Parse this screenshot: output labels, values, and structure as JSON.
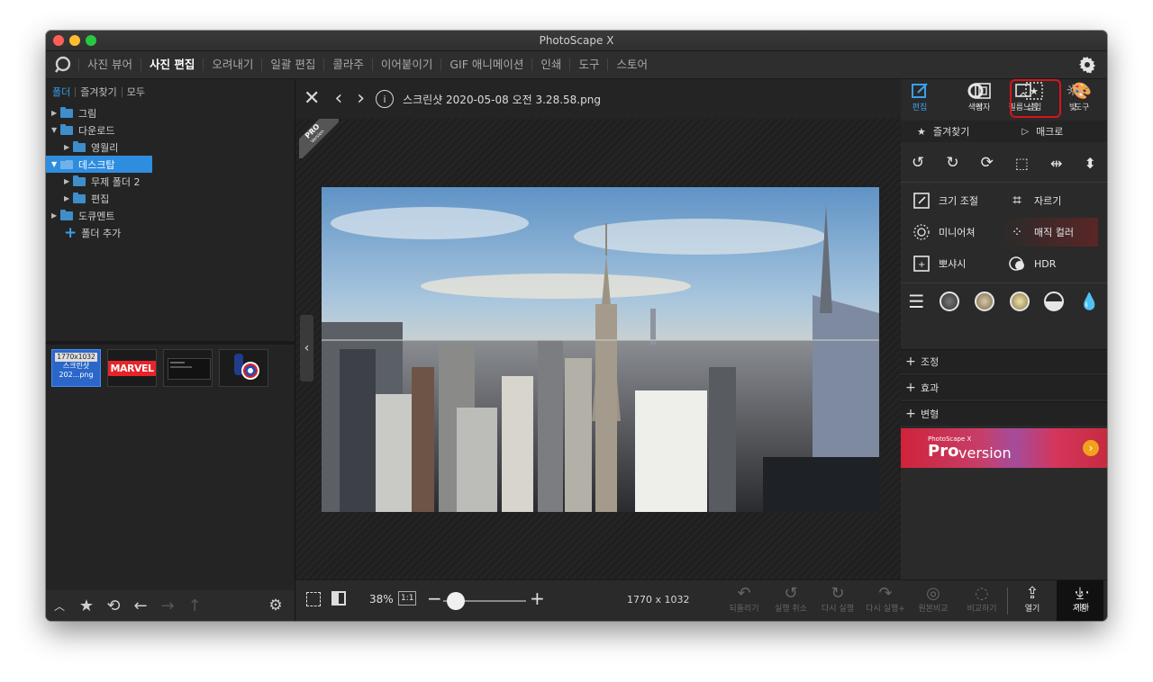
{
  "window": {
    "title": "PhotoScape X"
  },
  "menu": {
    "items": [
      "사진 뷰어",
      "사진 편집",
      "오려내기",
      "일괄 편집",
      "콜라주",
      "이어붙이기",
      "GIF 애니메이션",
      "인쇄",
      "도구",
      "스토어"
    ],
    "active": "사진 편집"
  },
  "left_panel": {
    "tabs": [
      "폴더",
      "즐겨찾기",
      "모두"
    ],
    "tree": [
      {
        "label": "그림",
        "expanded": false,
        "level": 0
      },
      {
        "label": "다운로드",
        "expanded": true,
        "level": 0
      },
      {
        "label": "영월리",
        "expanded": false,
        "level": 1
      },
      {
        "label": "데스크탑",
        "expanded": true,
        "level": 0,
        "selected": true
      },
      {
        "label": "무제 폴더 2",
        "expanded": false,
        "level": 1
      },
      {
        "label": "편집",
        "expanded": false,
        "level": 1
      },
      {
        "label": "도큐멘트",
        "expanded": false,
        "level": 0
      }
    ],
    "add_folder": "폴더 추가",
    "thumbnails": [
      {
        "line1": "1770x1032",
        "line2": "스크린샷",
        "line3": "202...png",
        "selected": true
      },
      {
        "label": "MARVEL"
      },
      {
        "label": ""
      },
      {
        "label": ""
      }
    ]
  },
  "editor": {
    "filename": "스크린샷 2020-05-08 오전 3.28.58.png",
    "pro_badge": "PRO",
    "pro_badge_sub": "Version",
    "zoom": "38%",
    "one_to_one": "1:1",
    "dimensions": "1770 x 1032"
  },
  "bottom_actions": [
    {
      "label": "되돌리기",
      "enabled": false
    },
    {
      "label": "실행 취소",
      "enabled": false
    },
    {
      "label": "다시 실행",
      "enabled": false
    },
    {
      "label": "다시 실행+",
      "enabled": false
    },
    {
      "label": "원본비교",
      "enabled": false
    },
    {
      "label": "비교하기",
      "enabled": false
    },
    {
      "label": "열기",
      "enabled": true
    },
    {
      "label": "저장",
      "enabled": true
    },
    {
      "label": "기타",
      "enabled": true
    }
  ],
  "right_toolbar": [
    {
      "label": "편집",
      "icon": "edit-icon",
      "active": true
    },
    {
      "label": "색상",
      "icon": "color-icon"
    },
    {
      "label": "필름느낌",
      "icon": "film-icon"
    },
    {
      "label": "빛",
      "icon": "light-icon"
    },
    {
      "label": "액자",
      "icon": "frame-icon"
    },
    {
      "label": "삽입",
      "icon": "insert-icon",
      "highlighted": true
    },
    {
      "label": "도구",
      "icon": "tools-icon"
    }
  ],
  "right_panel": {
    "favorites": "즐겨찾기",
    "macro": "매크로",
    "edit_buttons": [
      "크기 조절",
      "자르기",
      "미니어쳐",
      "매직 컬러",
      "뽀샤시",
      "HDR"
    ],
    "sections": [
      "조정",
      "효과",
      "변형"
    ],
    "banner_small": "PhotoScape X",
    "banner_pro": "Pro",
    "banner_version": "version"
  },
  "colors": {
    "accent": "#3aa0ea",
    "highlight_red": "#d9141c",
    "window_bg": "#222222"
  }
}
